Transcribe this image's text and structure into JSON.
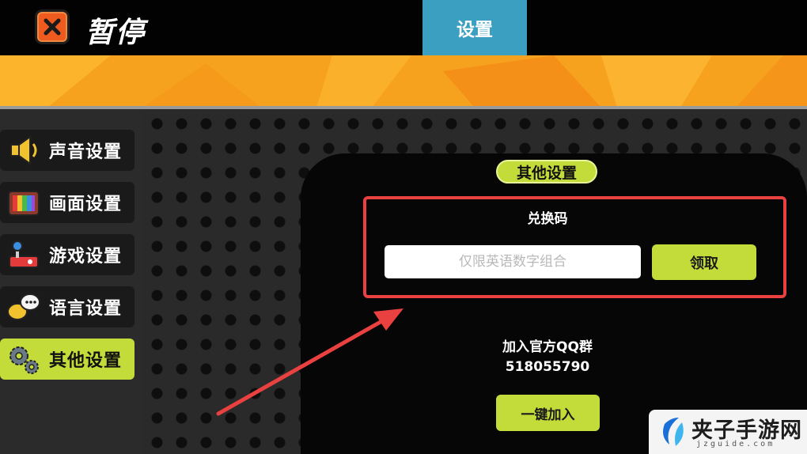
{
  "topbar": {
    "pause_title": "暂停",
    "active_tab": "设置"
  },
  "sidebar": {
    "items": [
      {
        "label": "声音设置",
        "icon": "speaker-icon",
        "active": false
      },
      {
        "label": "画面设置",
        "icon": "tv-icon",
        "active": false
      },
      {
        "label": "游戏设置",
        "icon": "joystick-icon",
        "active": false
      },
      {
        "label": "语言设置",
        "icon": "chat-bubbles-icon",
        "active": false
      },
      {
        "label": "其他设置",
        "icon": "gears-icon",
        "active": true
      }
    ]
  },
  "panel": {
    "title": "其他设置",
    "redeem": {
      "label": "兑换码",
      "placeholder": "仅限英语数字组合",
      "value": "",
      "claim_label": "领取"
    },
    "qq_group": {
      "label": "加入官方QQ群",
      "number": "518055790",
      "join_label": "一键加入"
    }
  },
  "watermark": {
    "text": "夹子手游网",
    "sub": "jzguide.com"
  },
  "colors": {
    "accent_green": "#c4dc3a",
    "tab_blue": "#3a9fc0",
    "banner_orange": "#f7a21e",
    "close_orange": "#ef5a1f",
    "highlight_red": "#e8413f"
  }
}
